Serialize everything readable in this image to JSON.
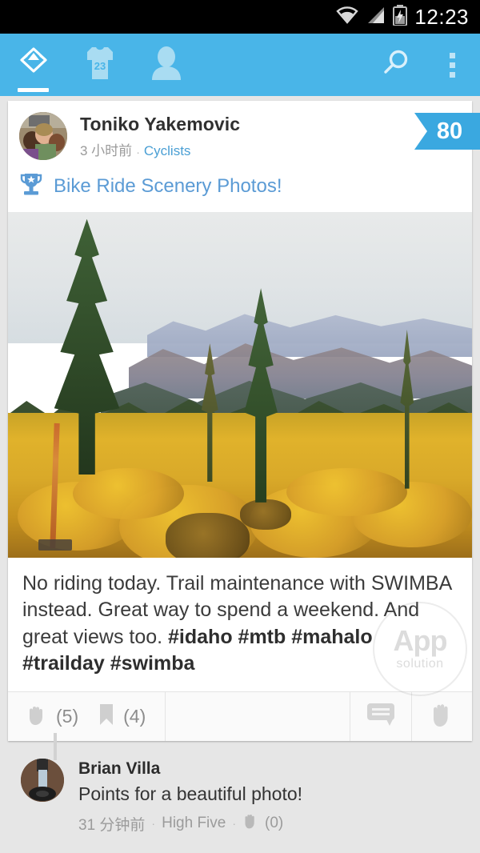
{
  "statusbar": {
    "time": "12:23",
    "icons": [
      "wifi-icon",
      "signal-icon",
      "battery-charging-icon"
    ]
  },
  "appbar": {
    "background": "#49b5e8",
    "tabs": [
      {
        "name": "home-tab",
        "icon": "logo-diamond-icon",
        "active": true
      },
      {
        "name": "teams-tab",
        "icon": "jersey-icon",
        "jersey_number": "23",
        "active": false
      },
      {
        "name": "profile-tab",
        "icon": "person-icon",
        "active": false
      }
    ],
    "actions": [
      {
        "name": "search-action",
        "icon": "search-icon"
      },
      {
        "name": "overflow-action",
        "icon": "overflow-menu-icon"
      }
    ]
  },
  "post": {
    "author": "Toniko Yakemovic",
    "time": "3 小时前",
    "separator": "·",
    "group": "Cyclists",
    "score": "80",
    "title": "Bike Ride Scenery Photos!",
    "title_icon": "trophy-icon",
    "photo_alt": "mountain-scenery-photo",
    "body_plain_1": "No riding today. Trail maintenance with SWIMBA instead. Great way to spend a weekend. And great views too. ",
    "body_tags": "#idaho #mtb #mahalo #trailday #swimba",
    "actions": {
      "highfive_icon": "hand-icon",
      "highfive_count": "(5)",
      "bookmark_icon": "bookmark-icon",
      "bookmark_count": "(4)",
      "comment_button_icon": "comment-bubble-icon",
      "highfive_button_icon": "hand-icon"
    }
  },
  "comment": {
    "author": "Brian Villa",
    "text": "Points for a beautiful photo!",
    "time": "31 分钟前",
    "separator": "·",
    "label": "High Five",
    "highfive_icon": "hand-icon",
    "highfive_count": "(0)"
  },
  "watermark": {
    "main": "App",
    "sub": "solution"
  },
  "colors": {
    "accent": "#49b5e8",
    "link": "#4a9fd4",
    "title": "#5b9bd5",
    "ribbon": "#3aa8e0",
    "page_bg": "#e6e6e6"
  }
}
